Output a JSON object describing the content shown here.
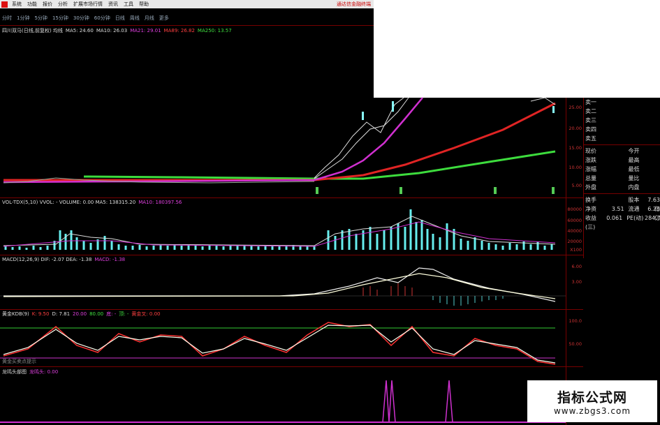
{
  "menu": {
    "items": [
      "系统",
      "功能",
      "报价",
      "分析",
      "扩展市场行情",
      "资讯",
      "工具",
      "帮助"
    ],
    "banner": "通达信金融终端"
  },
  "period_tabs": [
    "分时",
    "1分钟",
    "5分钟",
    "15分钟",
    "30分钟",
    "60分钟",
    "日线",
    "周线",
    "月线",
    "更多"
  ],
  "main_chart": {
    "info": [
      {
        "text": "四川双马(日线,前复权) 均线",
        "color": "#dddddd"
      },
      {
        "text": "MA5: 24.60",
        "color": "#dddddd"
      },
      {
        "text": "MA10: 26.03",
        "color": "#dddddd"
      },
      {
        "text": "MA21: 29.01",
        "color": "#e040e0"
      },
      {
        "text": "MA89: 26.82",
        "color": "#ff4040"
      },
      {
        "text": "MA250: 13.57",
        "color": "#40e040"
      }
    ],
    "y_ticks": [
      "25.00",
      "20.00",
      "15.00",
      "10.00",
      "5.00"
    ]
  },
  "vol_chart": {
    "info": [
      {
        "text": "VOL-TDX(5,10) VVOL: -  VOLUME: 0.00  MA5: 138315.20",
        "color": "#dddddd"
      },
      {
        "text": "MA10: 180397.56",
        "color": "#e040e0"
      }
    ],
    "y_ticks": [
      "80000",
      "60000",
      "40000",
      "20000",
      "X100"
    ]
  },
  "macd_chart": {
    "info": [
      {
        "text": "MACD(12,26,9) DIF: -2.07  DEA: -1.38",
        "color": "#dddddd"
      },
      {
        "text": "MACD: -1.38",
        "color": "#e040e0"
      }
    ],
    "y_ticks": [
      "6.00",
      "3.00"
    ]
  },
  "kdj_chart": {
    "info": [
      {
        "text": "黄金KDB(9)",
        "color": "#dddddd"
      },
      {
        "text": "K: 9.50",
        "color": "#ff4040"
      },
      {
        "text": "D: 7.81",
        "color": "#dddddd"
      },
      {
        "text": "20.00",
        "color": "#e040e0"
      },
      {
        "text": "80.00",
        "color": "#40e040"
      },
      {
        "text": "底: -",
        "color": "#e040e0"
      },
      {
        "text": "顶: -",
        "color": "#40e040"
      },
      {
        "text": "黄金叉: 0.00",
        "color": "#ff4040"
      }
    ],
    "sub_label": "黄金买卖点提示",
    "y_ticks": [
      "100.0",
      "50.00"
    ]
  },
  "signal_chart": {
    "info": [
      {
        "text": "龙鸣头部图",
        "color": "#dddddd"
      },
      {
        "text": "龙鸣头: 0.00",
        "color": "#e040e0"
      }
    ]
  },
  "side_panel": {
    "asks": [
      "卖一",
      "卖二",
      "卖三",
      "卖四",
      "卖五"
    ],
    "quote_rows": [
      {
        "l": "现价",
        "v": "",
        "l2": "今开",
        "v2": ""
      },
      {
        "l": "涨跌",
        "v": "",
        "l2": "最高",
        "v2": ""
      },
      {
        "l": "涨幅",
        "v": "",
        "l2": "最低",
        "v2": ""
      },
      {
        "l": "总量",
        "v": "",
        "l2": "量比",
        "v2": ""
      },
      {
        "l": "外盘",
        "v": "",
        "l2": "内盘",
        "v2": ""
      }
    ],
    "stat_rows": [
      {
        "l": "换手",
        "v": "",
        "l2": "股本",
        "v2": "7.63亿"
      },
      {
        "l": "净资",
        "v": "3.51",
        "l2": "流通",
        "v2": "6.29亿"
      },
      {
        "l": "收益(三)",
        "v": "0.061",
        "l2": "PE(动)",
        "v2": "284.7"
      }
    ]
  },
  "watermark": {
    "title": "指标公式网",
    "url": "www.zbgs3.com"
  }
}
